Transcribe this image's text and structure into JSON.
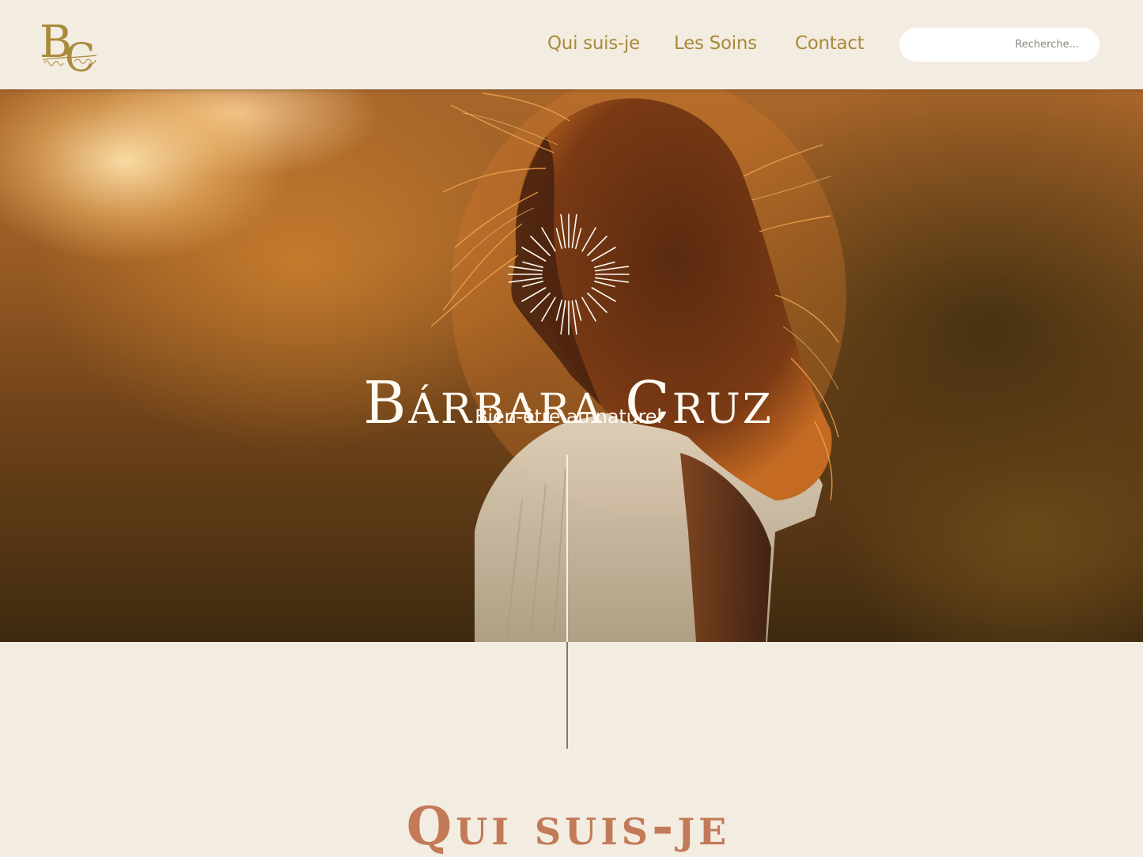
{
  "header": {
    "logo": {
      "monogram": "BC",
      "signature": "Bárbara Cruz",
      "color": "#a88a3a"
    },
    "nav": [
      {
        "label": "Qui suis-je"
      },
      {
        "label": "Les Soins"
      },
      {
        "label": "Contact"
      }
    ],
    "search": {
      "placeholder": "Recherche..."
    }
  },
  "hero": {
    "emblem_icon": "sun-burst-icon",
    "title": "Bárbara Cruz",
    "subtitle": "Bien-être au naturel",
    "image_description_icon": "hero-photo"
  },
  "section": {
    "title": "Qui suis-je"
  },
  "colors": {
    "background": "#f3ece1",
    "nav_text": "#a88a3a",
    "hero_text": "#fffaf2",
    "section_title": "#c27a58",
    "divider": "#7c7f68"
  }
}
